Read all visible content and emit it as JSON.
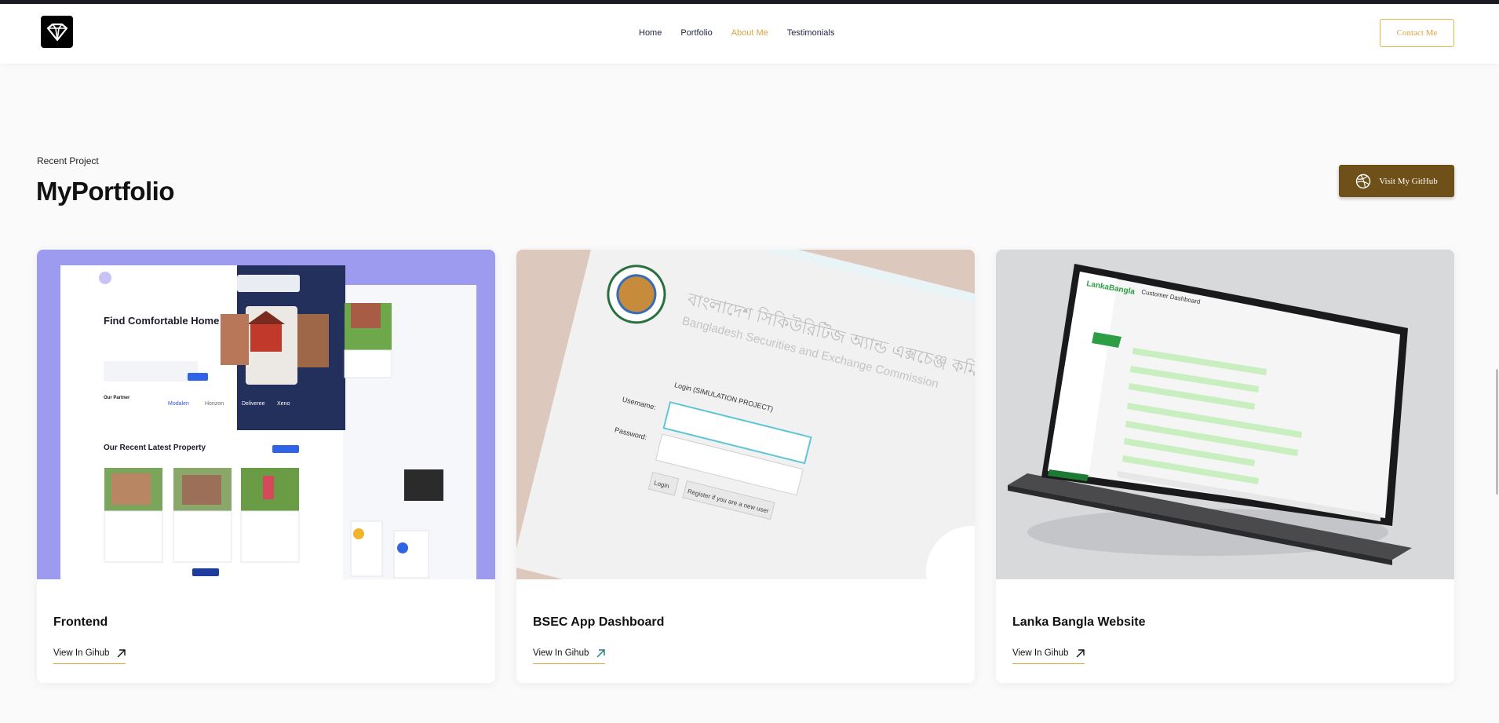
{
  "header": {
    "nav": [
      "Home",
      "Portfolio",
      "About Me",
      "Testimonials"
    ],
    "active_nav": "About Me",
    "contact_label": "Contact Me"
  },
  "section": {
    "eyebrow": "Recent Project",
    "title": "MyPortfolio",
    "github_label": "Visit My GitHub"
  },
  "projects": [
    {
      "title": "Frontend",
      "link": "View In Gihub",
      "thumb": {
        "hero": "Find Comfortable Home Here",
        "partner": "Our Partner",
        "partners": [
          "Modalen",
          "Horizon",
          "Deliveree",
          "Xeno"
        ],
        "recent": "Our Recent Latest Property"
      }
    },
    {
      "title": "BSEC App Dashboard",
      "link": "View In Gihub",
      "thumb": {
        "bangla": "বাংলাদেশ সিকিউরিটিজ অ্যান্ড এক্সচেঞ্জ কমিশন",
        "org": "Bangladesh Securities and Exchange Commission",
        "login_title": "Login (SIMULATION PROJECT)",
        "username": "Username:",
        "password": "Password:",
        "login_btn": "Login",
        "register_btn": "Register if you are a new user"
      }
    },
    {
      "title": "Lanka Bangla Website",
      "link": "View In Gihub",
      "thumb": {
        "brand": "LankaBangla",
        "screen_title": "Customer Dashboard"
      }
    }
  ],
  "colors": {
    "accent": "#d9a441",
    "github_btn": "#6e5018",
    "nav_text": "#1d2244"
  }
}
